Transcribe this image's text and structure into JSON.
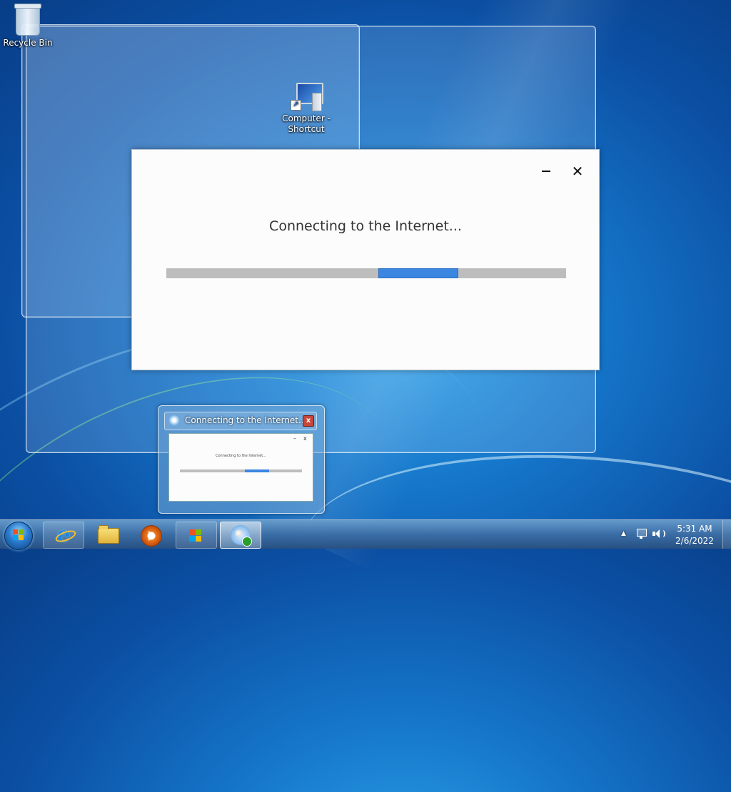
{
  "desktop": {
    "icons": [
      {
        "label": "Recycle Bin",
        "icon": "recycle-bin-icon"
      },
      {
        "label": "Computer - Shortcut",
        "icon": "computer-icon"
      }
    ]
  },
  "dialog": {
    "message": "Connecting to the Internet...",
    "minimize_glyph": "–",
    "close_glyph": "✕",
    "progress": {
      "track_color": "#bdbdbd",
      "chunk_color": "#3b86e0",
      "chunk_start_fraction": 0.53,
      "chunk_end_fraction": 0.73
    }
  },
  "thumbnail": {
    "title": "Connecting to the Internet......",
    "close_glyph": "x",
    "mini_message": "Connecting to the Internet...",
    "mini_min": "–",
    "mini_close": "x"
  },
  "taskbar": {
    "pinned": [
      {
        "name": "internet-explorer",
        "icon": "ie-icon"
      },
      {
        "name": "windows-explorer",
        "icon": "folder-icon"
      },
      {
        "name": "windows-media-player",
        "icon": "media-icon"
      },
      {
        "name": "windows-logo-app",
        "icon": "windows-logo-icon"
      },
      {
        "name": "connecting-app",
        "icon": "update-disc-icon"
      }
    ],
    "tray": {
      "show_hidden": "▲",
      "network": "network-icon",
      "volume": "volume-icon"
    },
    "clock": {
      "time": "5:31 AM",
      "date": "2/6/2022"
    }
  }
}
